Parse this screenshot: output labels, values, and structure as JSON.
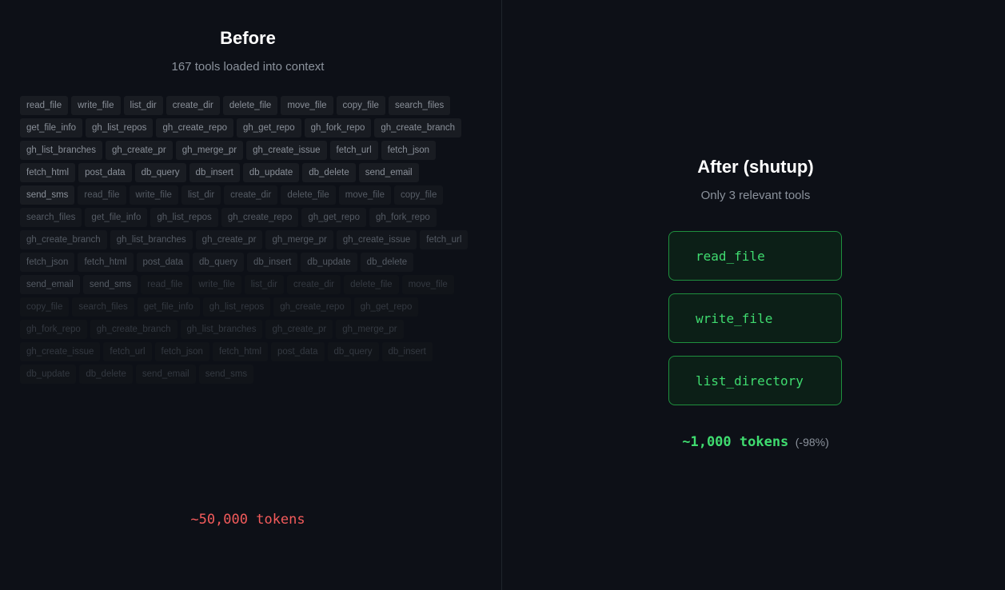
{
  "before": {
    "title": "Before",
    "subtitle": "167 tools loaded into context",
    "tokens": "~50,000 tokens",
    "tools_tier1": [
      "read_file",
      "write_file",
      "list_dir",
      "create_dir",
      "delete_file",
      "move_file",
      "copy_file",
      "search_files",
      "get_file_info",
      "gh_list_repos",
      "gh_create_repo",
      "gh_get_repo",
      "gh_fork_repo",
      "gh_create_branch",
      "gh_list_branches",
      "gh_create_pr",
      "gh_merge_pr",
      "gh_create_issue",
      "fetch_url",
      "fetch_json",
      "fetch_html",
      "post_data",
      "db_query",
      "db_insert",
      "db_update",
      "db_delete",
      "send_email",
      "send_sms"
    ],
    "tools_tier2": [
      "read_file",
      "write_file",
      "list_dir",
      "create_dir",
      "delete_file",
      "move_file",
      "copy_file",
      "search_files",
      "get_file_info",
      "gh_list_repos",
      "gh_create_repo",
      "gh_get_repo",
      "gh_fork_repo",
      "gh_create_branch",
      "gh_list_branches",
      "gh_create_pr",
      "gh_merge_pr",
      "gh_create_issue",
      "fetch_url",
      "fetch_json",
      "fetch_html",
      "post_data",
      "db_query",
      "db_insert",
      "db_update",
      "db_delete",
      "send_email",
      "send_sms"
    ],
    "tools_tier3": [
      "read_file",
      "write_file",
      "list_dir",
      "create_dir",
      "delete_file",
      "move_file",
      "copy_file",
      "search_files",
      "get_file_info",
      "gh_list_repos",
      "gh_create_repo",
      "gh_get_repo",
      "gh_fork_repo",
      "gh_create_branch",
      "gh_list_branches",
      "gh_create_pr",
      "gh_merge_pr",
      "gh_create_issue",
      "fetch_url",
      "fetch_json",
      "fetch_html",
      "post_data",
      "db_query",
      "db_insert",
      "db_update",
      "db_delete",
      "send_email",
      "send_sms"
    ]
  },
  "after": {
    "title": "After (shutup)",
    "subtitle": "Only 3 relevant tools",
    "tools": [
      "read_file",
      "write_file",
      "list_directory"
    ],
    "tokens": "~1,000 tokens",
    "reduction": "(-98%)"
  },
  "colors": {
    "background": "#0d1017",
    "accent_green": "#3fdb6f",
    "accent_red": "#f35b5b"
  }
}
